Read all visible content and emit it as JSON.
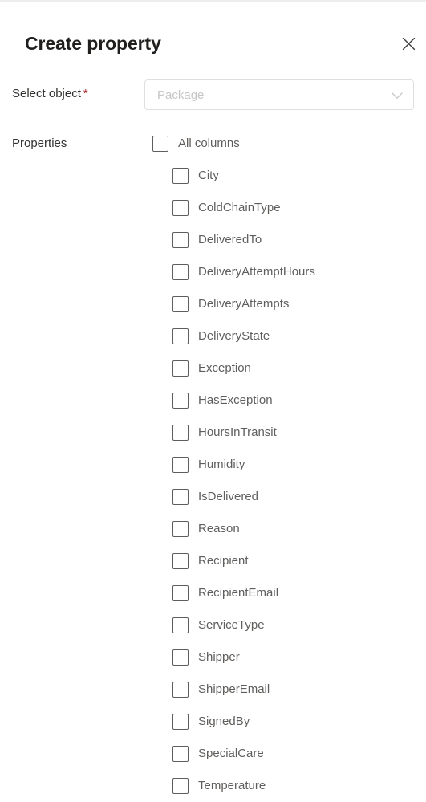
{
  "panel": {
    "title": "Create property",
    "close_icon": "close-icon"
  },
  "select_object": {
    "label": "Select object",
    "required_marker": "*",
    "placeholder": "Package",
    "value": "",
    "chevron_icon": "chevron-down-icon"
  },
  "properties": {
    "label": "Properties",
    "select_all": {
      "label": "All columns",
      "checked": false
    },
    "items": [
      {
        "label": "City",
        "checked": false
      },
      {
        "label": "ColdChainType",
        "checked": false
      },
      {
        "label": "DeliveredTo",
        "checked": false
      },
      {
        "label": "DeliveryAttemptHours",
        "checked": false
      },
      {
        "label": "DeliveryAttempts",
        "checked": false
      },
      {
        "label": "DeliveryState",
        "checked": false
      },
      {
        "label": "Exception",
        "checked": false
      },
      {
        "label": "HasException",
        "checked": false
      },
      {
        "label": "HoursInTransit",
        "checked": false
      },
      {
        "label": "Humidity",
        "checked": false
      },
      {
        "label": "IsDelivered",
        "checked": false
      },
      {
        "label": "Reason",
        "checked": false
      },
      {
        "label": "Recipient",
        "checked": false
      },
      {
        "label": "RecipientEmail",
        "checked": false
      },
      {
        "label": "ServiceType",
        "checked": false
      },
      {
        "label": "Shipper",
        "checked": false
      },
      {
        "label": "ShipperEmail",
        "checked": false
      },
      {
        "label": "SignedBy",
        "checked": false
      },
      {
        "label": "SpecialCare",
        "checked": false
      },
      {
        "label": "Temperature",
        "checked": false
      }
    ]
  },
  "colors": {
    "required": "#a4262c",
    "title": "#201f1e",
    "label": "#323130",
    "item_text": "#605e5c",
    "border": "#e1dfdd",
    "placeholder": "#c8c6c4",
    "checkbox_border": "#605e5c",
    "background": "#ffffff"
  }
}
